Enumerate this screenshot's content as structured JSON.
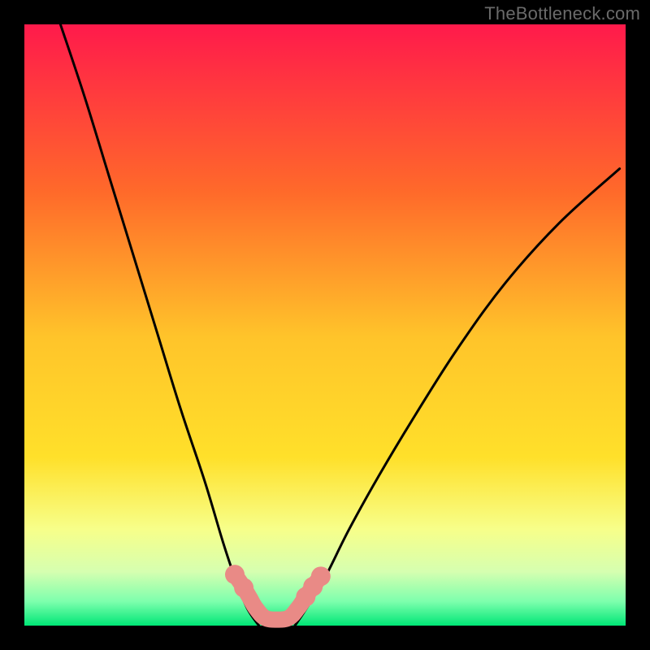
{
  "watermark": "TheBottleneck.com",
  "chart_data": {
    "type": "line",
    "title": "",
    "xlabel": "",
    "ylabel": "",
    "xlim": [
      0,
      100
    ],
    "ylim": [
      0,
      100
    ],
    "background_gradient": {
      "top": "#ff1a4b",
      "mid_upper": "#ff8a2a",
      "mid": "#ffe02a",
      "lower": "#f7ff8a",
      "bottom": "#00e676"
    },
    "series": [
      {
        "name": "left-curve",
        "x": [
          6,
          10,
          14,
          18,
          22,
          26,
          30,
          33,
          35,
          37,
          39
        ],
        "y": [
          100,
          88,
          75,
          62,
          49,
          36,
          24,
          14,
          8,
          3,
          0
        ]
      },
      {
        "name": "right-curve",
        "x": [
          45,
          47,
          50,
          54,
          59,
          65,
          72,
          80,
          89,
          99
        ],
        "y": [
          0,
          3,
          8,
          16,
          25,
          35,
          46,
          57,
          67,
          76
        ]
      },
      {
        "name": "valley-band",
        "x": [
          35,
          36.5,
          37.5,
          38.5,
          40,
          42,
          44,
          45.5,
          46.8,
          48,
          49.3
        ],
        "y": [
          8.5,
          6.3,
          4.6,
          2.9,
          1.3,
          1.0,
          1.3,
          2.9,
          4.8,
          6.5,
          8.2
        ]
      }
    ],
    "valley_markers": {
      "left": [
        {
          "x": 35,
          "y": 8.5
        },
        {
          "x": 36.5,
          "y": 6.3
        }
      ],
      "right": [
        {
          "x": 46.8,
          "y": 4.8
        },
        {
          "x": 48,
          "y": 6.5
        },
        {
          "x": 49.3,
          "y": 8.2
        }
      ]
    }
  }
}
